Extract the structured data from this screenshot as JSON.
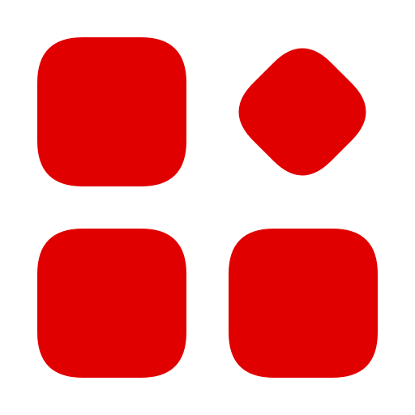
{
  "icon": {
    "name": "apps-grid-icon",
    "color": "#E00000",
    "background": "#FFFFFF",
    "tiles": [
      {
        "name": "tile-top-left",
        "shape": "rounded-square"
      },
      {
        "name": "tile-top-right",
        "shape": "rounded-diamond"
      },
      {
        "name": "tile-bottom-left",
        "shape": "rounded-square"
      },
      {
        "name": "tile-bottom-right",
        "shape": "rounded-square"
      }
    ]
  }
}
